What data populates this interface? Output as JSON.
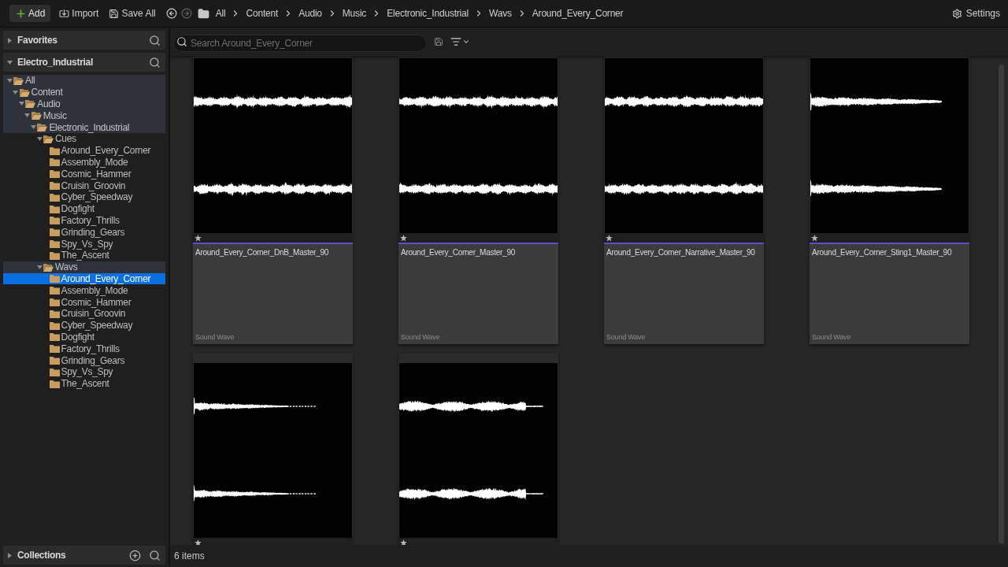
{
  "toolbar": {
    "buttons": [
      {
        "label": "Add",
        "kind": "add"
      },
      {
        "label": "Import",
        "kind": "import"
      },
      {
        "label": "Save All",
        "kind": "save"
      }
    ],
    "navigation": {
      "back": {
        "disabled": false
      },
      "forward": {
        "disabled": true
      }
    },
    "breadcrumbs": [
      "All",
      "Content",
      "Audio",
      "Music",
      "Electronic_Industrial",
      "Wavs",
      "Around_Every_Corner"
    ],
    "settings": {
      "label": "Settings"
    }
  },
  "sidebar": {
    "sections": [
      {
        "label": "Favorites",
        "expanded": false
      },
      {
        "label": "Electro_Industrial",
        "expanded": true,
        "tree": [
          {
            "label": "All",
            "expanded": true,
            "selected": false,
            "highlighted": true,
            "children": [
              {
                "label": "Content",
                "expanded": true,
                "selected": false,
                "highlighted": true,
                "children": [
                  {
                    "label": "Audio",
                    "expanded": true,
                    "selected": false,
                    "highlighted": true,
                    "children": [
                      {
                        "label": "Music",
                        "expanded": true,
                        "selected": false,
                        "highlighted": true,
                        "children": [
                          {
                            "label": "Electronic_Industrial",
                            "expanded": true,
                            "selected": false,
                            "highlighted": true,
                            "children": [
                              {
                                "label": "Cues",
                                "expanded": true,
                                "selected": false,
                                "highlighted": false,
                                "children": [
                                  {
                                    "label": "Around_Every_Corner",
                                    "selected": false,
                                    "highlighted": false
                                  },
                                  {
                                    "label": "Assembly_Mode",
                                    "selected": false,
                                    "highlighted": false
                                  },
                                  {
                                    "label": "Cosmic_Hammer",
                                    "selected": false,
                                    "highlighted": false
                                  },
                                  {
                                    "label": "Cruisin_Groovin",
                                    "selected": false,
                                    "highlighted": false
                                  },
                                  {
                                    "label": "Cyber_Speedway",
                                    "selected": false,
                                    "highlighted": false
                                  },
                                  {
                                    "label": "Dogfight",
                                    "selected": false,
                                    "highlighted": false
                                  },
                                  {
                                    "label": "Factory_Thrills",
                                    "selected": false,
                                    "highlighted": false
                                  },
                                  {
                                    "label": "Grinding_Gears",
                                    "selected": false,
                                    "highlighted": false
                                  },
                                  {
                                    "label": "Spy_Vs_Spy",
                                    "selected": false,
                                    "highlighted": false
                                  },
                                  {
                                    "label": "The_Ascent",
                                    "selected": false,
                                    "highlighted": false
                                  }
                                ]
                              },
                              {
                                "label": "Wavs",
                                "expanded": true,
                                "selected": false,
                                "highlighted": true,
                                "children": [
                                  {
                                    "label": "Around_Every_Corner",
                                    "selected": true,
                                    "highlighted": false
                                  },
                                  {
                                    "label": "Assembly_Mode",
                                    "selected": false,
                                    "highlighted": false
                                  },
                                  {
                                    "label": "Cosmic_Hammer",
                                    "selected": false,
                                    "highlighted": false
                                  },
                                  {
                                    "label": "Cruisin_Groovin",
                                    "selected": false,
                                    "highlighted": false
                                  },
                                  {
                                    "label": "Cyber_Speedway",
                                    "selected": false,
                                    "highlighted": false
                                  },
                                  {
                                    "label": "Dogfight",
                                    "selected": false,
                                    "highlighted": false
                                  },
                                  {
                                    "label": "Factory_Thrills",
                                    "selected": false,
                                    "highlighted": false
                                  },
                                  {
                                    "label": "Grinding_Gears",
                                    "selected": false,
                                    "highlighted": false
                                  },
                                  {
                                    "label": "Spy_Vs_Spy",
                                    "selected": false,
                                    "highlighted": false
                                  },
                                  {
                                    "label": "The_Ascent",
                                    "selected": false,
                                    "highlighted": false
                                  }
                                ]
                              }
                            ]
                          }
                        ]
                      }
                    ]
                  }
                ]
              }
            ]
          }
        ]
      }
    ],
    "collections": {
      "label": "Collections",
      "expanded": false
    }
  },
  "content": {
    "search": {
      "placeholder": "Search Around_Every_Corner"
    },
    "assets": [
      {
        "kind": "full",
        "name": "Around_Every_Corner_DnB_Master_90",
        "type": "Sound Wave",
        "color": "#5b4fc9"
      },
      {
        "kind": "full",
        "name": "Around_Every_Corner_Master_90",
        "type": "Sound Wave",
        "color": "#5b4fc9"
      },
      {
        "kind": "full",
        "name": "Around_Every_Corner_Narrative_Master_90",
        "type": "Sound Wave",
        "color": "#5b4fc9"
      },
      {
        "kind": "long_fade",
        "name": "Around_Every_Corner_Sting1_Master_90",
        "type": "Sound Wave",
        "color": "#5b4fc9"
      },
      {
        "kind": "short_fade"
      },
      {
        "kind": "pulsing"
      }
    ],
    "status": "6 items"
  }
}
